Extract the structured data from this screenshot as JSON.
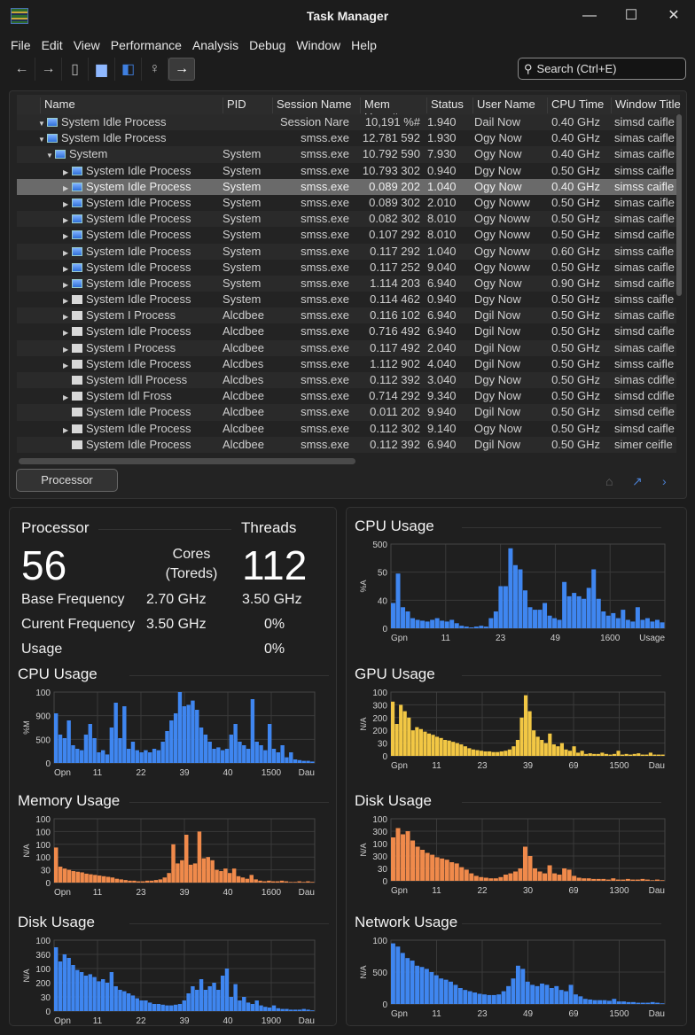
{
  "window": {
    "title": "Task Manager",
    "minimize": "—",
    "maximize": "☐",
    "close": "✕"
  },
  "menu": [
    "File",
    "Edit",
    "View",
    "Performance",
    "Analysis",
    "Debug",
    "Window",
    "Help"
  ],
  "toolbar": [
    {
      "icon": "back-arrow-icon",
      "glyph": "←"
    },
    {
      "icon": "forward-arrow-icon",
      "glyph": "→"
    },
    {
      "icon": "clipboard-icon",
      "glyph": "▯"
    },
    {
      "icon": "trash-icon",
      "glyph": "▆"
    },
    {
      "icon": "windows-icon",
      "glyph": "◧"
    },
    {
      "icon": "monitor-icon",
      "glyph": "♀"
    },
    {
      "icon": "run-arrow-icon",
      "glyph": "→",
      "active": true
    }
  ],
  "search": {
    "placeholder": "Search (Ctrl+E)"
  },
  "table": {
    "columns": [
      "Name",
      "PID",
      "Session Name",
      "Mem Usag#",
      "Status",
      "User Name",
      "CPU Time",
      "Window Title"
    ],
    "rows": [
      {
        "lvl": 0,
        "exp": "open",
        "icon": "blue",
        "name": "System Idle Process",
        "pid": "",
        "session": "Session Nare",
        "mem": "10,191 %#",
        "status": "1.940",
        "user": "Dail Now",
        "cpu": "0.40 GHz",
        "win": "simsd caifle"
      },
      {
        "lvl": 0,
        "exp": "open",
        "icon": "blue",
        "name": "System Idle Process",
        "pid": "",
        "session": "smss.exe",
        "mem": "12.781 592",
        "status": "1.930",
        "user": "Ogy Now",
        "cpu": "0.40 GHz",
        "win": "simas caifle"
      },
      {
        "lvl": 1,
        "exp": "open",
        "icon": "blue",
        "name": "System",
        "pid": "System",
        "session": "smss.exe",
        "mem": "10.792 590",
        "status": "7.930",
        "user": "Ogy Now",
        "cpu": "0.40 GHz",
        "win": "simas caifle"
      },
      {
        "lvl": 2,
        "exp": "closed",
        "icon": "blue",
        "name": "System Idle Process",
        "pid": "System",
        "session": "smss.exe",
        "mem": "10.793 302",
        "status": "0.940",
        "user": "Dgy Now",
        "cpu": "0.50 GHz",
        "win": "simss caifle"
      },
      {
        "lvl": 2,
        "exp": "closed",
        "icon": "blue",
        "name": "System Idle Process",
        "pid": "System",
        "session": "smss.exe",
        "mem": "0.089 202",
        "status": "1.040",
        "user": "Ogy Now",
        "cpu": "0.40 GHz",
        "win": "simss caifle",
        "selected": true
      },
      {
        "lvl": 2,
        "exp": "closed",
        "icon": "blue",
        "name": "System Idle Process",
        "pid": "System",
        "session": "smss.exe",
        "mem": "0.089 302",
        "status": "2.010",
        "user": "Ogy Noww",
        "cpu": "0.50 GHz",
        "win": "simas caifle"
      },
      {
        "lvl": 2,
        "exp": "closed",
        "icon": "blue",
        "name": "System Idle Process",
        "pid": "System",
        "session": "smss.exe",
        "mem": "0.082 302",
        "status": "8.010",
        "user": "Ogy Noww",
        "cpu": "0.50 GHz",
        "win": "simas caifle"
      },
      {
        "lvl": 2,
        "exp": "closed",
        "icon": "blue",
        "name": "System Idle Process",
        "pid": "System",
        "session": "smss.exe",
        "mem": "0.107 292",
        "status": "8.010",
        "user": "Ogy Noww",
        "cpu": "0.50 GHz",
        "win": "simsd caifle"
      },
      {
        "lvl": 2,
        "exp": "closed",
        "icon": "blue",
        "name": "System Idle Process",
        "pid": "System",
        "session": "smss.exe",
        "mem": "0.117 292",
        "status": "1.040",
        "user": "Ogy Noww",
        "cpu": "0.60 GHz",
        "win": "simss caifle"
      },
      {
        "lvl": 2,
        "exp": "closed",
        "icon": "blue",
        "name": "System Idle Process",
        "pid": "System",
        "session": "smss.exe",
        "mem": "0.117 252",
        "status": "9.040",
        "user": "Ogy Noww",
        "cpu": "0.50 GHz",
        "win": "simas caifle"
      },
      {
        "lvl": 2,
        "exp": "closed",
        "icon": "blue",
        "name": "System Idle Process",
        "pid": "System",
        "session": "smss.exe",
        "mem": "1.114 203",
        "status": "6.940",
        "user": "Ogy Now",
        "cpu": "0.90 GHz",
        "win": "simsd caifle"
      },
      {
        "lvl": 2,
        "exp": "closed",
        "icon": "folder",
        "name": "System Idle Process",
        "pid": "System",
        "session": "smss.exe",
        "mem": "0.114 462",
        "status": "0.940",
        "user": "Dgy Now",
        "cpu": "0.50 GHz",
        "win": "simss caifle"
      },
      {
        "lvl": 2,
        "exp": "closed",
        "icon": "folder",
        "name": "System I Process",
        "pid": "Alcdbee",
        "session": "smss.exe",
        "mem": "0.116 102",
        "status": "6.940",
        "user": "Dgil Now",
        "cpu": "0.50 GHz",
        "win": "simas caifle"
      },
      {
        "lvl": 2,
        "exp": "closed",
        "icon": "folder",
        "name": "System Idle Process",
        "pid": "Alcdbee",
        "session": "smss.exe",
        "mem": "0.716 492",
        "status": "6.940",
        "user": "Dgil Now",
        "cpu": "0.50 GHz",
        "win": "simsd caifle"
      },
      {
        "lvl": 2,
        "exp": "closed",
        "icon": "folder",
        "name": "System I Process",
        "pid": "Alcdbee",
        "session": "smss.exe",
        "mem": "0.117 492",
        "status": "2.040",
        "user": "Dgil Now",
        "cpu": "0.50 GHz",
        "win": "simas caifle"
      },
      {
        "lvl": 2,
        "exp": "closed",
        "icon": "folder",
        "name": "System Idle Process",
        "pid": "Alcdbes",
        "session": "smss.exe",
        "mem": "1.112 902",
        "status": "4.040",
        "user": "Dgil Now",
        "cpu": "0.50 GHz",
        "win": "simss caifle"
      },
      {
        "lvl": 2,
        "exp": "none",
        "icon": "folder",
        "name": "System Idll Process",
        "pid": "Alcdbes",
        "session": "smss.exe",
        "mem": "0.112 392",
        "status": "3.040",
        "user": "Dgy Now",
        "cpu": "0.50 GHz",
        "win": "simas cdifle"
      },
      {
        "lvl": 2,
        "exp": "closed",
        "icon": "folder",
        "name": "System Idl Fross",
        "pid": "Alcdbee",
        "session": "smss.exe",
        "mem": "0.714 292",
        "status": "9.340",
        "user": "Dgy Now",
        "cpu": "0.50 GHz",
        "win": "simsd cdifle"
      },
      {
        "lvl": 2,
        "exp": "none",
        "icon": "folder",
        "name": "System Idle Process",
        "pid": "Alcdbee",
        "session": "smss.exe",
        "mem": "0.011 202",
        "status": "9.940",
        "user": "Dgil Now",
        "cpu": "0.50 GHz",
        "win": "simsd ceifle"
      },
      {
        "lvl": 2,
        "exp": "closed",
        "icon": "folder",
        "name": "System Idle Process",
        "pid": "Alcdbee",
        "session": "smss.exe",
        "mem": "0.112 302",
        "status": "9.140",
        "user": "Ogy Now",
        "cpu": "0.50 GHz",
        "win": "simsd caifle"
      },
      {
        "lvl": 2,
        "exp": "none",
        "icon": "folder",
        "name": "System Idle Process",
        "pid": "Alcdbee",
        "session": "smss.exe",
        "mem": "0.112 392",
        "status": "6.940",
        "user": "Dgil Now",
        "cpu": "0.50 GHz",
        "win": "simer ceifle"
      }
    ],
    "processor_button": "Processor"
  },
  "processor": {
    "title": "Processor",
    "threads_title": "Threads",
    "cores": "56",
    "cores_label_1": "Cores",
    "cores_label_2": "(Toreds)",
    "threads": "112",
    "base_label": "Base Frequency",
    "base_value": "2.70 GHz",
    "base_value_2": "3.50 GHz",
    "current_label": "Curent Frequency",
    "current_value": "3.50 GHz",
    "current_value_2": "0%",
    "usage_label": "Usage",
    "usage_value": "0%"
  },
  "chart_data": [
    {
      "id": "cpu-left",
      "type": "bar",
      "title": "CPU Usage",
      "color": "#3f86f0",
      "ylabel": "%M",
      "ylim": [
        0,
        100
      ],
      "yticks": [
        "100",
        "900",
        "500",
        "0"
      ],
      "xticks": [
        "Opn",
        "11",
        "22",
        "39",
        "40",
        "1500",
        "Dau"
      ],
      "values": [
        70,
        40,
        35,
        60,
        25,
        20,
        18,
        40,
        55,
        35,
        15,
        18,
        12,
        50,
        85,
        35,
        80,
        20,
        30,
        18,
        15,
        18,
        15,
        20,
        18,
        30,
        45,
        60,
        70,
        100,
        80,
        82,
        88,
        75,
        50,
        40,
        30,
        20,
        22,
        18,
        20,
        40,
        55,
        30,
        25,
        20,
        90,
        30,
        25,
        18,
        55,
        20,
        15,
        25,
        8,
        15,
        5,
        4,
        3,
        3,
        2
      ]
    },
    {
      "id": "memory",
      "type": "bar",
      "title": "Memory Usage",
      "color": "#f08a4b",
      "ylabel": "N/A",
      "ylim": [
        0,
        100
      ],
      "yticks": [
        "100",
        "100",
        "100",
        "100",
        "30",
        "0"
      ],
      "xticks": [
        "Opn",
        "11",
        "23",
        "39",
        "40",
        "1600",
        "Dau"
      ],
      "values": [
        55,
        25,
        22,
        20,
        18,
        17,
        16,
        14,
        13,
        12,
        11,
        10,
        9,
        8,
        6,
        5,
        4,
        3,
        3,
        2,
        2,
        3,
        3,
        4,
        5,
        8,
        15,
        60,
        30,
        35,
        75,
        28,
        30,
        80,
        38,
        40,
        35,
        20,
        18,
        22,
        15,
        22,
        10,
        8,
        6,
        12,
        5,
        3,
        2,
        3,
        2,
        2,
        3,
        2,
        1,
        1,
        2,
        1,
        2,
        1
      ]
    },
    {
      "id": "disk-left",
      "type": "bar",
      "title": "Disk Usage",
      "color": "#3f86f0",
      "ylabel": "N/A",
      "ylim": [
        0,
        100
      ],
      "yticks": [
        "100",
        "360",
        "100",
        "200",
        "30",
        "0"
      ],
      "xticks": [
        "Opn",
        "11",
        "22",
        "39",
        "40",
        "1900",
        "Dau"
      ],
      "values": [
        90,
        70,
        80,
        75,
        65,
        58,
        55,
        50,
        52,
        48,
        42,
        45,
        40,
        55,
        35,
        30,
        28,
        25,
        22,
        18,
        15,
        15,
        12,
        10,
        10,
        9,
        8,
        8,
        9,
        10,
        15,
        25,
        35,
        30,
        45,
        30,
        35,
        40,
        30,
        50,
        60,
        20,
        38,
        15,
        20,
        12,
        10,
        15,
        8,
        6,
        5,
        8,
        4,
        3,
        3,
        2,
        2,
        2,
        3,
        2,
        1
      ]
    },
    {
      "id": "cpu-right",
      "type": "bar",
      "title": "CPU Usage",
      "color": "#3f86f0",
      "ylabel": "%A",
      "ylim": [
        0,
        100
      ],
      "yticks": [
        "500",
        "50",
        "40",
        "0"
      ],
      "xticks": [
        "Gpn",
        "11",
        "23",
        "49",
        "1600",
        "Usage"
      ],
      "values": [
        30,
        65,
        25,
        20,
        12,
        10,
        9,
        8,
        10,
        12,
        9,
        8,
        10,
        6,
        3,
        2,
        1,
        2,
        3,
        2,
        12,
        20,
        50,
        50,
        95,
        75,
        70,
        45,
        25,
        22,
        22,
        30,
        15,
        12,
        10,
        55,
        38,
        42,
        38,
        35,
        48,
        70,
        35,
        20,
        15,
        18,
        12,
        22,
        10,
        8,
        25,
        10,
        12,
        8,
        10,
        7
      ]
    },
    {
      "id": "gpu",
      "type": "bar",
      "title": "GPU Usage",
      "color": "#f2c744",
      "ylabel": "N/A",
      "ylim": [
        0,
        100
      ],
      "yticks": [
        "100",
        "300",
        "200",
        "200",
        "30",
        "0"
      ],
      "xticks": [
        "Gpn",
        "11",
        "23",
        "39",
        "69",
        "1500",
        "Dau"
      ],
      "values": [
        85,
        50,
        80,
        70,
        60,
        40,
        45,
        42,
        38,
        35,
        33,
        30,
        28,
        25,
        24,
        22,
        20,
        18,
        15,
        12,
        10,
        9,
        8,
        7,
        7,
        6,
        6,
        7,
        8,
        10,
        15,
        25,
        60,
        95,
        70,
        40,
        30,
        25,
        20,
        35,
        18,
        15,
        20,
        10,
        8,
        15,
        5,
        8,
        3,
        4,
        3,
        3,
        5,
        3,
        2,
        3,
        8,
        2,
        3,
        2,
        3,
        4,
        2,
        2,
        5,
        2,
        2,
        2
      ]
    },
    {
      "id": "disk-right",
      "type": "bar",
      "title": "Disk Usage",
      "color": "#f08a4b",
      "ylabel": "N/A",
      "ylim": [
        0,
        100
      ],
      "yticks": [
        "100",
        "300",
        "100",
        "300",
        "30",
        "0"
      ],
      "xticks": [
        "Gpn",
        "11",
        "22",
        "30",
        "69",
        "1300",
        "Dau"
      ],
      "values": [
        70,
        85,
        75,
        80,
        65,
        55,
        50,
        45,
        42,
        38,
        36,
        34,
        30,
        28,
        22,
        18,
        12,
        8,
        6,
        5,
        4,
        4,
        6,
        10,
        12,
        15,
        20,
        55,
        40,
        20,
        15,
        12,
        25,
        12,
        10,
        20,
        18,
        8,
        5,
        4,
        4,
        3,
        3,
        3,
        2,
        4,
        2,
        2,
        3,
        2,
        2,
        3,
        2,
        1,
        2,
        1
      ]
    },
    {
      "id": "network",
      "type": "bar",
      "title": "Network Usage",
      "color": "#3f86f0",
      "ylabel": "N/A",
      "ylim": [
        0,
        100
      ],
      "yticks": [
        "100",
        "500",
        "0"
      ],
      "xticks": [
        "Gpn",
        "11",
        "23",
        "49",
        "69",
        "1500",
        "Dau"
      ],
      "values": [
        95,
        90,
        80,
        72,
        68,
        60,
        58,
        55,
        50,
        45,
        40,
        38,
        35,
        30,
        25,
        22,
        20,
        18,
        16,
        15,
        14,
        14,
        15,
        20,
        28,
        40,
        60,
        55,
        35,
        30,
        28,
        32,
        30,
        25,
        28,
        22,
        20,
        30,
        15,
        12,
        8,
        7,
        6,
        6,
        6,
        5,
        8,
        4,
        4,
        3,
        3,
        2,
        2,
        2,
        3,
        2,
        1
      ]
    }
  ]
}
